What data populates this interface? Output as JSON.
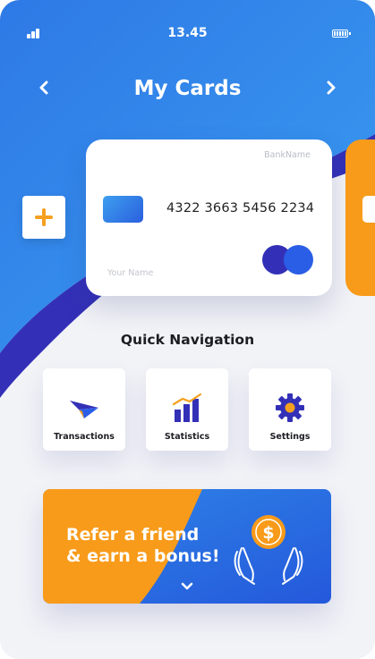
{
  "status_bar": {
    "time": "13.45"
  },
  "header": {
    "title": "My Cards"
  },
  "card": {
    "bank_name": "BankName",
    "number": "4322 3663 5456 2234",
    "holder": "Your Name"
  },
  "quick_navigation": {
    "title": "Quick Navigation",
    "items": [
      {
        "label": "Transactions",
        "icon": "paper-plane-icon"
      },
      {
        "label": "Statistics",
        "icon": "bar-chart-icon"
      },
      {
        "label": "Settings",
        "icon": "gear-icon"
      }
    ]
  },
  "banner": {
    "line1": "Refer a friend",
    "line2": "& earn a bonus!",
    "coin_symbol": "$"
  },
  "colors": {
    "blue": "#2f86e8",
    "deep_blue": "#3330b7",
    "orange": "#f89b1a",
    "background": "#f2f3f7"
  }
}
